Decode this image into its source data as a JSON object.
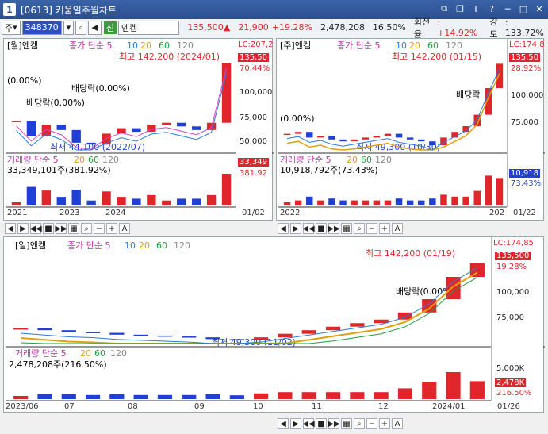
{
  "window": {
    "number": "1",
    "title": "[0613] 키움일주월차트"
  },
  "toolbar": {
    "market": "주",
    "code": "348370",
    "type_badge": "신",
    "stock_name": "엔켐",
    "price": "135,500",
    "change": "21,900",
    "change_pct": "+19.28%",
    "volume": "2,478,208",
    "vol_pct": "16.50%",
    "turnover_label": "회전율",
    "turnover": ": +14.92%",
    "strength_label": "강도",
    "strength": ": 133.72%"
  },
  "monthly": {
    "header": "[월]엔켐",
    "ma_legend": [
      "종가 단순 5",
      "10",
      "20",
      "60",
      "120"
    ],
    "lc": "LC:207,2",
    "price_tag": "135,50",
    "pct_tag": "70.44%",
    "y_ticks": [
      "100,000",
      "75,000",
      "50,000"
    ],
    "high": "최고 142,200 (2024/01)",
    "low": "최저 44,100 (2022/07)",
    "div1": "배당락(0.00%)",
    "div2": "배당락(0.00%)",
    "left_pct": "(0.00%)",
    "vol_header": "거래량 단순 5",
    "vol_ma": [
      "20",
      "60",
      "120"
    ],
    "vol_value": "33,349,101주(381.92%)",
    "vol_tag": "33,349",
    "vol_pct_tag": "381.92",
    "x_labels": [
      "2021",
      "2023",
      "2024"
    ],
    "x_end": "01/02"
  },
  "weekly": {
    "header": "[주]엔켐",
    "ma_legend": [
      "종가 단순 5",
      "10",
      "20",
      "60",
      "120"
    ],
    "lc": "LC:174,8",
    "price_tag": "135,50",
    "pct_tag": "28.92%",
    "y_ticks": [
      "100,000",
      "75,000"
    ],
    "high": "최고 142,200 (01/15)",
    "low": "최저 49,300 (10/30)",
    "div": "배당락",
    "left_pct": "(0.00%)",
    "vol_header": "거래량 단순 5",
    "vol_ma": [
      "20",
      "60",
      "120"
    ],
    "vol_value": "10,918,792주(73.43%)",
    "vol_tag": "10,918",
    "vol_pct_tag": "73.43%",
    "x_labels": [
      "2022",
      "202"
    ],
    "x_end": "01/22"
  },
  "daily": {
    "header": "[일]엔켐",
    "ma_legend": [
      "종가 단순 5",
      "10",
      "20",
      "60",
      "120"
    ],
    "lc": "LC:174,85",
    "price_tag": "135,500",
    "pct_tag": "19.28%",
    "y_ticks": [
      "100,000",
      "75,000"
    ],
    "high": "최고 142,200 (01/19)",
    "low": "최저 49,300 (11/02)",
    "div": "배당락(0.00%)",
    "vol_header": "거래량 단순 5",
    "vol_ma": [
      "20",
      "60",
      "120"
    ],
    "vol_value": "2,478,208주(216.50%)",
    "vol_ticks": [
      "5,000K"
    ],
    "vol_tag": "2,478K",
    "vol_pct_tag": "216.50%",
    "x_labels": [
      "2023/06",
      "07",
      "08",
      "09",
      "10",
      "11",
      "12",
      "2024/01"
    ],
    "x_end": "01/26"
  },
  "colors": {
    "up": "#e0262b",
    "down": "#1f3fd6",
    "ma5": "#e040c0",
    "ma10": "#2a7bd6",
    "ma20": "#e0a010",
    "ma60": "#1f9f3f",
    "ma120": "#888888"
  },
  "chart_data": [
    {
      "type": "line",
      "title": "[월]엔켐",
      "ylim": [
        40000,
        145000
      ],
      "series": [
        {
          "name": "종가",
          "values": [
            72000,
            55000,
            68000,
            62000,
            48000,
            46000,
            58000,
            64000,
            60000,
            68000,
            70000,
            66000,
            62000,
            70000,
            135500
          ]
        }
      ]
    },
    {
      "type": "line",
      "title": "[주]엔켐",
      "ylim": [
        45000,
        145000
      ],
      "series": [
        {
          "name": "종가",
          "values": [
            62000,
            64000,
            58000,
            60000,
            56000,
            54000,
            56000,
            58000,
            60000,
            62000,
            58000,
            56000,
            54000,
            50000,
            58000,
            64000,
            70000,
            82000,
            110000,
            135500
          ]
        }
      ]
    },
    {
      "type": "line",
      "title": "[일]엔켐",
      "ylim": [
        45000,
        145000
      ],
      "series": [
        {
          "name": "종가",
          "values": [
            62000,
            60000,
            58000,
            57000,
            55000,
            54000,
            53000,
            52000,
            50000,
            49300,
            52000,
            56000,
            60000,
            64000,
            68000,
            72000,
            80000,
            95000,
            120000,
            135500
          ]
        }
      ]
    }
  ]
}
